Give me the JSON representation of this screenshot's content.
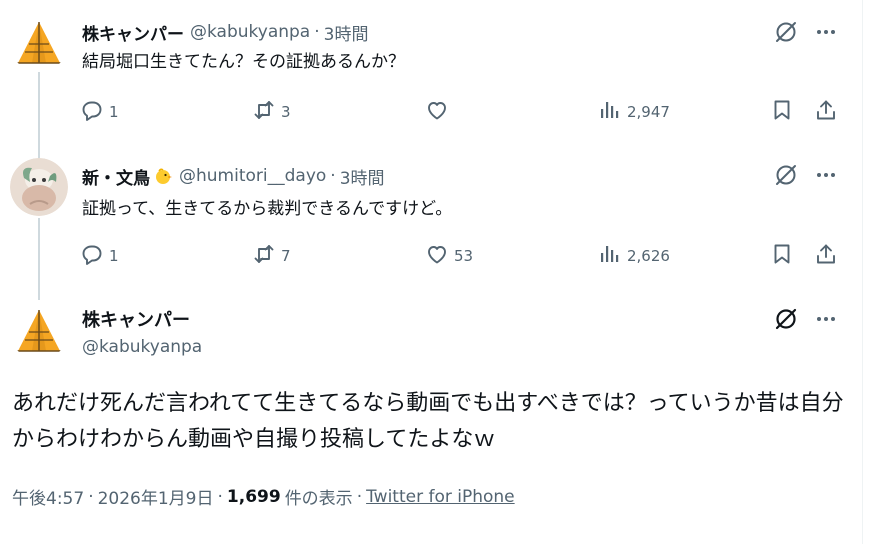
{
  "tweets": [
    {
      "name": "株キャンパー",
      "handle": "@kabukyanpa",
      "time": "3時間",
      "text": "結局堀口生きてたん？その証拠あるんか？",
      "replies": "1",
      "retweets": "3",
      "likes": "",
      "views": "2,947"
    },
    {
      "name": "新・文鳥",
      "emoji": "chick-emoji",
      "handle": "@humitori__dayo",
      "time": "3時間",
      "text": "証拠って、生きてるから裁判できるんですけど。",
      "replies": "1",
      "retweets": "7",
      "likes": "53",
      "views": "2,626"
    }
  ],
  "main_tweet": {
    "name": "株キャンパー",
    "handle": "@kabukyanpa",
    "text": "あれだけ死んだ言われてて生きてるなら動画でも出すべきでは？っていうか昔は自分からわけわからん動画や自撮り投稿してたよなｗ",
    "time": "午後4:57",
    "date": "2026年1月9日",
    "views_count": "1,699",
    "views_label": "件の表示",
    "source": "Twitter for iPhone"
  },
  "icons": {
    "reply": "reply-icon",
    "retweet": "retweet-icon",
    "like": "heart-icon",
    "views": "views-chart-icon",
    "bookmark": "bookmark-icon",
    "share": "share-icon",
    "grok": "grok-icon",
    "more": "more-icon"
  },
  "colors": {
    "text": "#0f1419",
    "secondary": "#536471",
    "thread_line": "#cfd9de",
    "tent_orange": "#f5a623"
  }
}
